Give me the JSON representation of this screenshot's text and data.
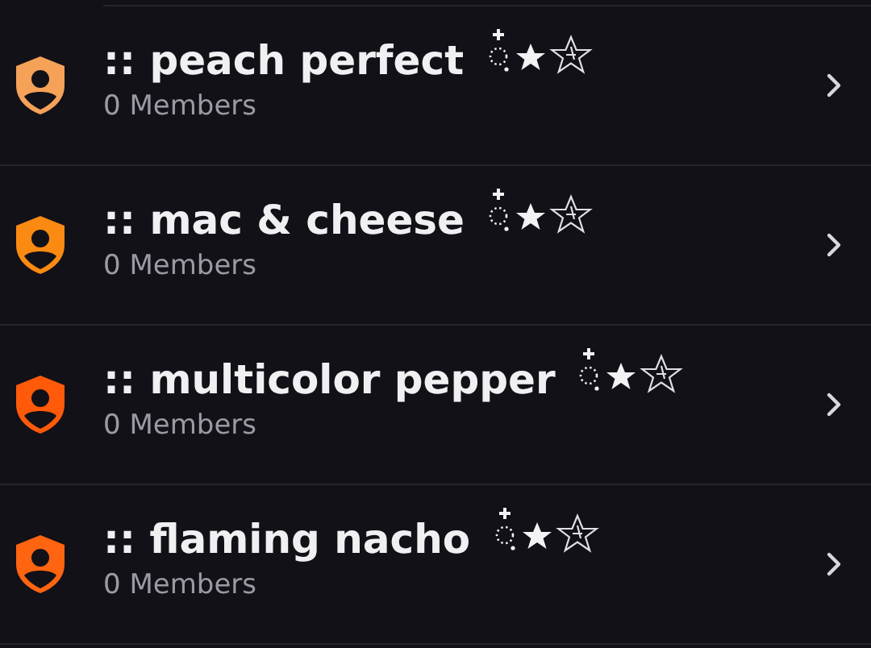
{
  "roles": [
    {
      "name": ":: peach perfect",
      "members": "0 Members",
      "color": "#f5a158"
    },
    {
      "name": ":: mac & cheese",
      "members": "0 Members",
      "color": "#fb8a12"
    },
    {
      "name": ":: multicolor pepper",
      "members": "0 Members",
      "color": "#ff5a0a"
    },
    {
      "name": ":: flaming nacho",
      "members": "0 Members",
      "color": "#ff6410"
    }
  ]
}
